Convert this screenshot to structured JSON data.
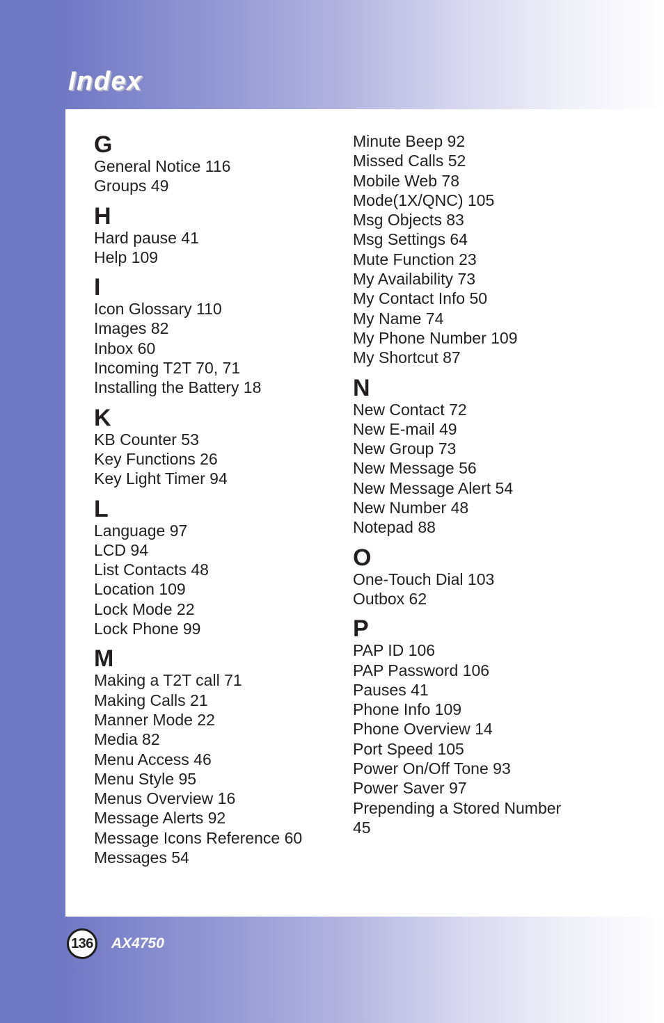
{
  "header": {
    "title": "Index"
  },
  "footer": {
    "page_number": "136",
    "model": "AX4750"
  },
  "colors": {
    "brand_blue": "#6f78c4",
    "text": "#231f20"
  },
  "index": {
    "left_column": [
      {
        "letter": "G",
        "entries": [
          "General Notice 116",
          "Groups 49"
        ]
      },
      {
        "letter": "H",
        "entries": [
          "Hard pause 41",
          "Help 109"
        ]
      },
      {
        "letter": "I",
        "entries": [
          "Icon Glossary 110",
          "Images 82",
          "Inbox 60",
          "Incoming T2T 70, 71",
          "Installing the Battery 18"
        ]
      },
      {
        "letter": "K",
        "entries": [
          "KB Counter 53",
          "Key Functions 26",
          "Key Light Timer 94"
        ]
      },
      {
        "letter": "L",
        "entries": [
          "Language 97",
          "LCD 94",
          "List Contacts 48",
          "Location 109",
          "Lock Mode 22",
          "Lock Phone 99"
        ]
      },
      {
        "letter": "M",
        "entries": [
          "Making a T2T call 71",
          "Making Calls 21",
          "Manner Mode 22",
          "Media 82",
          "Menu Access 46",
          "Menu Style 95",
          "Menus Overview 16",
          "Message Alerts 92",
          "Message Icons Reference 60",
          "Messages 54"
        ]
      }
    ],
    "right_column": [
      {
        "letter": "",
        "entries": [
          "Minute Beep 92",
          "Missed Calls 52",
          "Mobile Web 78",
          "Mode(1X/QNC) 105",
          "Msg Objects 83",
          "Msg Settings 64",
          "Mute Function 23",
          "My Availability 73",
          "My Contact Info 50",
          "My Name 74",
          "My Phone Number 109",
          "My Shortcut 87"
        ]
      },
      {
        "letter": "N",
        "entries": [
          "New Contact 72",
          "New E-mail 49",
          "New Group 73",
          "New Message 56",
          "New Message Alert 54",
          "New Number 48",
          "Notepad 88"
        ]
      },
      {
        "letter": "O",
        "entries": [
          "One-Touch Dial 103",
          "Outbox 62"
        ]
      },
      {
        "letter": "P",
        "entries": [
          "PAP ID 106",
          "PAP Password 106",
          "Pauses 41",
          "Phone Info 109",
          "Phone Overview 14",
          "Port Speed 105",
          "Power On/Off Tone 93",
          "Power Saver 97",
          "Prepending a Stored Number 45"
        ]
      }
    ]
  }
}
